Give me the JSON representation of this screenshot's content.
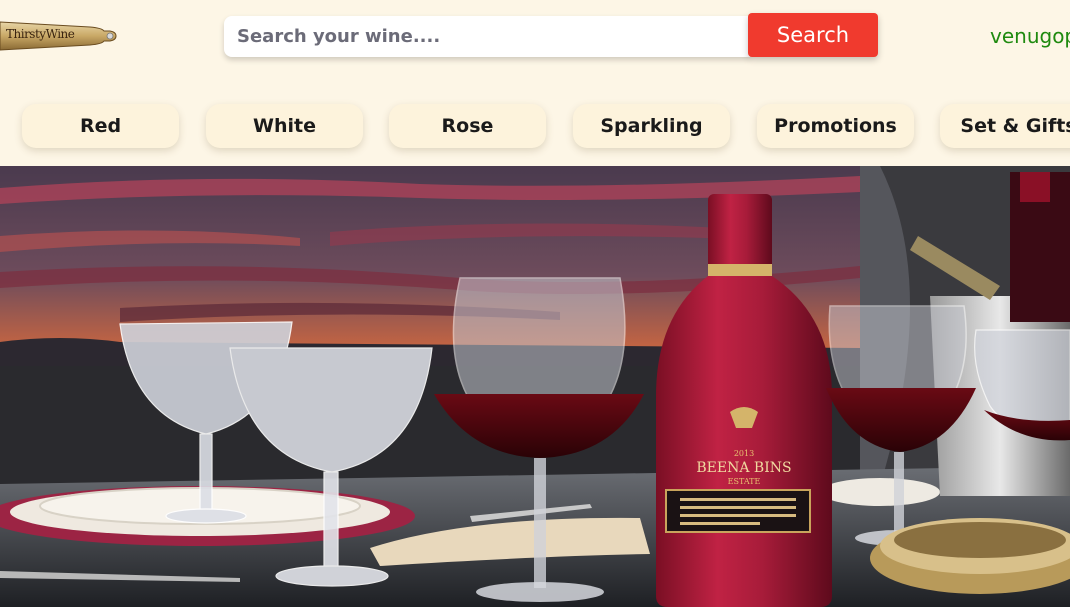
{
  "header": {
    "logo_text": "ThirstyWine",
    "search_placeholder": "Search your wine....",
    "search_button_label": "Search",
    "username": "venugop"
  },
  "categories": [
    {
      "label": "Red"
    },
    {
      "label": "White"
    },
    {
      "label": "Rose"
    },
    {
      "label": "Sparkling"
    },
    {
      "label": "Promotions"
    },
    {
      "label": "Set & Gifts"
    }
  ],
  "hero": {
    "bottle_label_line1": "BEENA BINS",
    "bottle_label_year": "2013",
    "bottle_label_line2": "ESTATE"
  },
  "colors": {
    "background": "#fdf6e6",
    "search_button": "#f03a2e",
    "username": "#1f8a0f",
    "category_pill": "#fdf3dc",
    "bottle": "#a81c3a"
  }
}
